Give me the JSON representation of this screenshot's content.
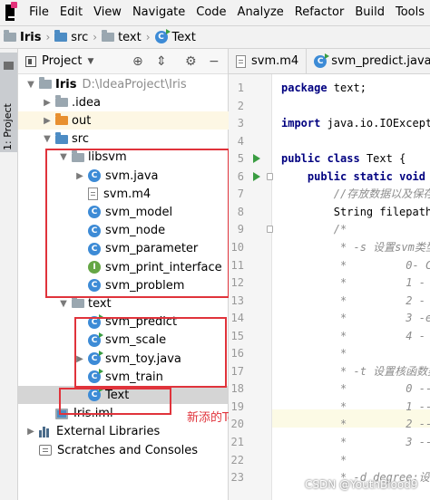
{
  "menu": [
    "File",
    "Edit",
    "View",
    "Navigate",
    "Code",
    "Analyze",
    "Refactor",
    "Build",
    "Tools"
  ],
  "breadcrumb": [
    "Iris",
    "src",
    "text",
    "Text"
  ],
  "left_stripe": {
    "label": "1: Project"
  },
  "project_panel": {
    "title": "Project",
    "icons": [
      "target-icon",
      "collapse-icon",
      "gear-icon",
      "minimize-icon"
    ]
  },
  "tree": [
    {
      "label": "Iris",
      "path": "D:\\IdeaProject\\Iris",
      "indent": 0,
      "arrow": "▼",
      "icon": "folder-gray",
      "bold": true
    },
    {
      "label": ".idea",
      "indent": 1,
      "arrow": "▶",
      "icon": "folder-gray"
    },
    {
      "label": "out",
      "indent": 1,
      "arrow": "▶",
      "icon": "folder-orange",
      "highlight": true
    },
    {
      "label": "src",
      "indent": 1,
      "arrow": "▼",
      "icon": "folder-blue"
    },
    {
      "label": "libsvm",
      "indent": 2,
      "arrow": "▼",
      "icon": "folder-gray"
    },
    {
      "label": "svm.java",
      "indent": 3,
      "arrow": "▶",
      "icon": "class"
    },
    {
      "label": "svm.m4",
      "indent": 3,
      "arrow": "",
      "icon": "file"
    },
    {
      "label": "svm_model",
      "indent": 3,
      "arrow": "",
      "icon": "class"
    },
    {
      "label": "svm_node",
      "indent": 3,
      "arrow": "",
      "icon": "class"
    },
    {
      "label": "svm_parameter",
      "indent": 3,
      "arrow": "",
      "icon": "class"
    },
    {
      "label": "svm_print_interface",
      "indent": 3,
      "arrow": "",
      "icon": "interface"
    },
    {
      "label": "svm_problem",
      "indent": 3,
      "arrow": "",
      "icon": "class"
    },
    {
      "label": "text",
      "indent": 2,
      "arrow": "▼",
      "icon": "folder-gray"
    },
    {
      "label": "svm_predict",
      "indent": 3,
      "arrow": "",
      "icon": "class-run"
    },
    {
      "label": "svm_scale",
      "indent": 3,
      "arrow": "",
      "icon": "class-run"
    },
    {
      "label": "svm_toy.java",
      "indent": 3,
      "arrow": "▶",
      "icon": "class-run"
    },
    {
      "label": "svm_train",
      "indent": 3,
      "arrow": "",
      "icon": "class-run"
    },
    {
      "label": "Text",
      "indent": 3,
      "arrow": "",
      "icon": "class-run",
      "selected": true
    },
    {
      "label": "Iris.iml",
      "indent": 1,
      "arrow": "",
      "icon": "module"
    },
    {
      "label": "External Libraries",
      "indent": 0,
      "arrow": "▶",
      "icon": "library"
    },
    {
      "label": "Scratches and Consoles",
      "indent": 0,
      "arrow": "",
      "icon": "scratch"
    }
  ],
  "annotation": "新添的Text文件",
  "editor": {
    "tabs": [
      "svm.m4",
      "svm_predict.java"
    ],
    "lines": [
      {
        "n": "1",
        "text": "package text;",
        "kind": "pkg"
      },
      {
        "n": "2",
        "text": ""
      },
      {
        "n": "3",
        "text": "import java.io.IOExcepti",
        "kind": "import"
      },
      {
        "n": "4",
        "text": ""
      },
      {
        "n": "5",
        "text": "public class Text {",
        "kind": "class",
        "run": true
      },
      {
        "n": "6",
        "text": "    public static void m",
        "kind": "method",
        "run": true,
        "fold": true
      },
      {
        "n": "7",
        "text": "        //存放数据以及保存",
        "kind": "comment"
      },
      {
        "n": "8",
        "text": "        String filepath",
        "kind": "plain"
      },
      {
        "n": "9",
        "text": "        /*",
        "kind": "comment",
        "fold": true
      },
      {
        "n": "10",
        "text": "         * -s 设置svm类型",
        "kind": "comment"
      },
      {
        "n": "11",
        "text": "         *         0- C",
        "kind": "comment"
      },
      {
        "n": "12",
        "text": "         *         1 -",
        "kind": "comment"
      },
      {
        "n": "13",
        "text": "         *         2 -",
        "kind": "comment"
      },
      {
        "n": "14",
        "text": "         *         3 -e",
        "kind": "comment"
      },
      {
        "n": "15",
        "text": "         *         4 -",
        "kind": "comment"
      },
      {
        "n": "16",
        "text": "         *",
        "kind": "comment"
      },
      {
        "n": "17",
        "text": "         * -t 设置核函数类",
        "kind": "comment"
      },
      {
        "n": "18",
        "text": "         *         0 --",
        "kind": "comment"
      },
      {
        "n": "19",
        "text": "         *         1 --",
        "kind": "comment"
      },
      {
        "n": "20",
        "text": "         *         2 --",
        "kind": "comment"
      },
      {
        "n": "21",
        "text": "         *         3 --",
        "kind": "comment"
      },
      {
        "n": "22",
        "text": "         *",
        "kind": "comment"
      },
      {
        "n": "23",
        "text": "         * -d degree:设置",
        "kind": "comment"
      }
    ]
  },
  "watermark": "CSDN @YouthBlood9"
}
